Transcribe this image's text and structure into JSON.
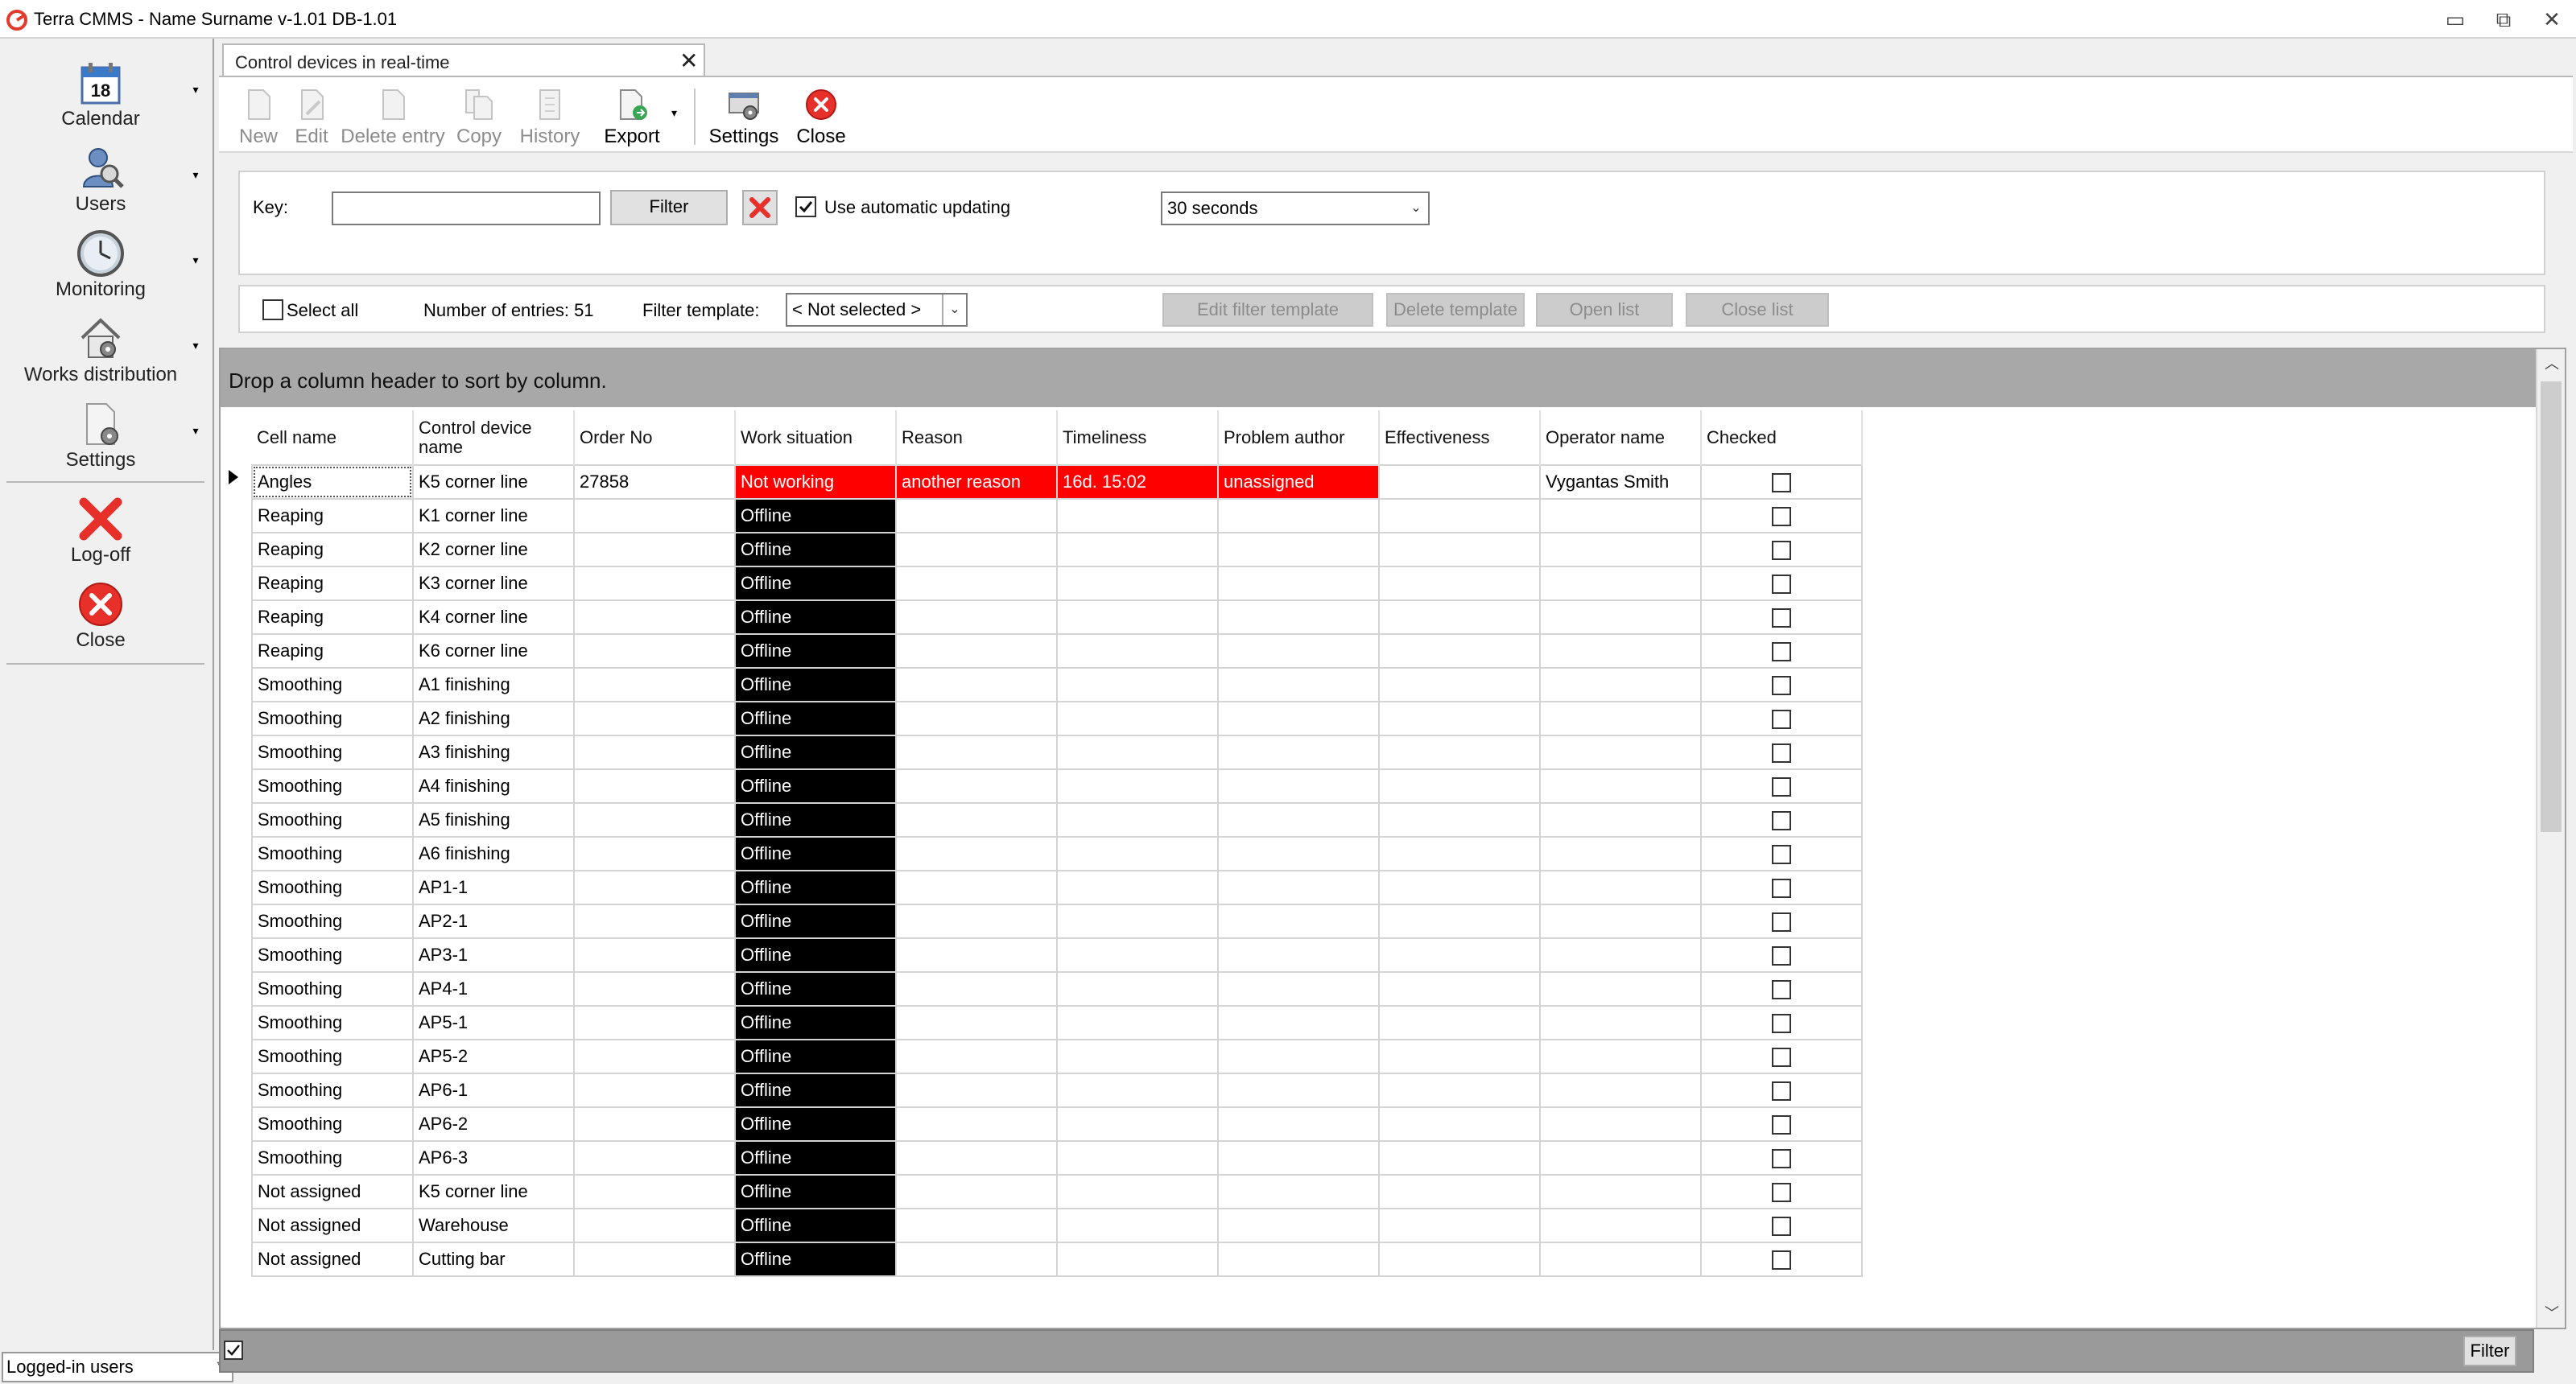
{
  "window": {
    "title": "Terra CMMS - Name Surname  v-1.01 DB-1.01",
    "minimize_glyph": "▭",
    "restore_glyph": "⧉",
    "close_glyph": "✕"
  },
  "sidebar": {
    "items": [
      {
        "label": "Calendar",
        "icon": "calendar-icon",
        "badge": "18"
      },
      {
        "label": "Users",
        "icon": "users-icon"
      },
      {
        "label": "Monitoring",
        "icon": "clock-icon"
      },
      {
        "label": "Works distribution",
        "icon": "house-gear-icon"
      },
      {
        "label": "Settings",
        "icon": "settings-document-icon"
      },
      {
        "label": "Log-off",
        "icon": "red-x-icon"
      },
      {
        "label": "Close",
        "icon": "red-circle-x-icon"
      }
    ],
    "logged_in_select": "Logged-in users"
  },
  "tab": {
    "label": "Control devices in real-time",
    "close_glyph": "✕"
  },
  "toolbar": {
    "new": "New",
    "edit": "Edit",
    "delete": "Delete entry",
    "copy": "Copy",
    "history": "History",
    "export": "Export",
    "settings": "Settings",
    "close": "Close"
  },
  "filter": {
    "key_label": "Key:",
    "key_value": "",
    "filter_button": "Filter",
    "auto_update_label": "Use automatic updating",
    "auto_update_checked": true,
    "interval_value": "30 seconds"
  },
  "actions": {
    "select_all": "Select all",
    "entries_count": "Number of entries: 51",
    "template_label": "Filter template:",
    "template_value": "< Not selected >",
    "edit_template": "Edit filter template",
    "delete_template": "Delete template",
    "open_list": "Open list",
    "close_list": "Close list"
  },
  "grid": {
    "group_hint": "Drop a column header to sort by column.",
    "headers": [
      "Cell name",
      "Control device name",
      "Order No",
      "Work situation",
      "Reason",
      "Timeliness",
      "Problem author",
      "Effectiveness",
      "Operator name",
      "Checked"
    ],
    "rows": [
      {
        "cell": "Angles",
        "device": "K5 corner line",
        "order": "27858",
        "status": "Not working",
        "reason": "another reason",
        "timeliness": "16d. 15:02",
        "author": "unassigned",
        "effectiveness": "",
        "operator": "Vygantas Smith",
        "checked": false
      },
      {
        "cell": "Reaping",
        "device": "K1 corner line",
        "order": "",
        "status": "Offline",
        "reason": "",
        "timeliness": "",
        "author": "",
        "effectiveness": "",
        "operator": "",
        "checked": false
      },
      {
        "cell": "Reaping",
        "device": "K2 corner line",
        "order": "",
        "status": "Offline",
        "reason": "",
        "timeliness": "",
        "author": "",
        "effectiveness": "",
        "operator": "",
        "checked": false
      },
      {
        "cell": "Reaping",
        "device": "K3 corner line",
        "order": "",
        "status": "Offline",
        "reason": "",
        "timeliness": "",
        "author": "",
        "effectiveness": "",
        "operator": "",
        "checked": false
      },
      {
        "cell": "Reaping",
        "device": "K4 corner line",
        "order": "",
        "status": "Offline",
        "reason": "",
        "timeliness": "",
        "author": "",
        "effectiveness": "",
        "operator": "",
        "checked": false
      },
      {
        "cell": "Reaping",
        "device": "K6 corner line",
        "order": "",
        "status": "Offline",
        "reason": "",
        "timeliness": "",
        "author": "",
        "effectiveness": "",
        "operator": "",
        "checked": false
      },
      {
        "cell": "Smoothing",
        "device": "A1 finishing",
        "order": "",
        "status": "Offline",
        "reason": "",
        "timeliness": "",
        "author": "",
        "effectiveness": "",
        "operator": "",
        "checked": false
      },
      {
        "cell": "Smoothing",
        "device": "A2 finishing",
        "order": "",
        "status": "Offline",
        "reason": "",
        "timeliness": "",
        "author": "",
        "effectiveness": "",
        "operator": "",
        "checked": false
      },
      {
        "cell": "Smoothing",
        "device": "A3 finishing",
        "order": "",
        "status": "Offline",
        "reason": "",
        "timeliness": "",
        "author": "",
        "effectiveness": "",
        "operator": "",
        "checked": false
      },
      {
        "cell": "Smoothing",
        "device": "A4 finishing",
        "order": "",
        "status": "Offline",
        "reason": "",
        "timeliness": "",
        "author": "",
        "effectiveness": "",
        "operator": "",
        "checked": false
      },
      {
        "cell": "Smoothing",
        "device": "A5 finishing",
        "order": "",
        "status": "Offline",
        "reason": "",
        "timeliness": "",
        "author": "",
        "effectiveness": "",
        "operator": "",
        "checked": false
      },
      {
        "cell": "Smoothing",
        "device": "A6 finishing",
        "order": "",
        "status": "Offline",
        "reason": "",
        "timeliness": "",
        "author": "",
        "effectiveness": "",
        "operator": "",
        "checked": false
      },
      {
        "cell": "Smoothing",
        "device": "AP1-1",
        "order": "",
        "status": "Offline",
        "reason": "",
        "timeliness": "",
        "author": "",
        "effectiveness": "",
        "operator": "",
        "checked": false
      },
      {
        "cell": "Smoothing",
        "device": "AP2-1",
        "order": "",
        "status": "Offline",
        "reason": "",
        "timeliness": "",
        "author": "",
        "effectiveness": "",
        "operator": "",
        "checked": false
      },
      {
        "cell": "Smoothing",
        "device": "AP3-1",
        "order": "",
        "status": "Offline",
        "reason": "",
        "timeliness": "",
        "author": "",
        "effectiveness": "",
        "operator": "",
        "checked": false
      },
      {
        "cell": "Smoothing",
        "device": "AP4-1",
        "order": "",
        "status": "Offline",
        "reason": "",
        "timeliness": "",
        "author": "",
        "effectiveness": "",
        "operator": "",
        "checked": false
      },
      {
        "cell": "Smoothing",
        "device": "AP5-1",
        "order": "",
        "status": "Offline",
        "reason": "",
        "timeliness": "",
        "author": "",
        "effectiveness": "",
        "operator": "",
        "checked": false
      },
      {
        "cell": "Smoothing",
        "device": "AP5-2",
        "order": "",
        "status": "Offline",
        "reason": "",
        "timeliness": "",
        "author": "",
        "effectiveness": "",
        "operator": "",
        "checked": false
      },
      {
        "cell": "Smoothing",
        "device": "AP6-1",
        "order": "",
        "status": "Offline",
        "reason": "",
        "timeliness": "",
        "author": "",
        "effectiveness": "",
        "operator": "",
        "checked": false
      },
      {
        "cell": "Smoothing",
        "device": "AP6-2",
        "order": "",
        "status": "Offline",
        "reason": "",
        "timeliness": "",
        "author": "",
        "effectiveness": "",
        "operator": "",
        "checked": false
      },
      {
        "cell": "Smoothing",
        "device": "AP6-3",
        "order": "",
        "status": "Offline",
        "reason": "",
        "timeliness": "",
        "author": "",
        "effectiveness": "",
        "operator": "",
        "checked": false
      },
      {
        "cell": "Not assigned",
        "device": "K5 corner line",
        "order": "",
        "status": "Offline",
        "reason": "",
        "timeliness": "",
        "author": "",
        "effectiveness": "",
        "operator": "",
        "checked": false
      },
      {
        "cell": "Not assigned",
        "device": "Warehouse",
        "order": "",
        "status": "Offline",
        "reason": "",
        "timeliness": "",
        "author": "",
        "effectiveness": "",
        "operator": "",
        "checked": false
      },
      {
        "cell": "Not assigned",
        "device": "Cutting bar",
        "order": "",
        "status": "Offline",
        "reason": "",
        "timeliness": "",
        "author": "",
        "effectiveness": "",
        "operator": "",
        "checked": false
      }
    ]
  },
  "footer": {
    "filter_button": "Filter"
  },
  "colors": {
    "alert": "#ff0000",
    "offline": "#000000",
    "group_panel": "#a8a8a8"
  }
}
